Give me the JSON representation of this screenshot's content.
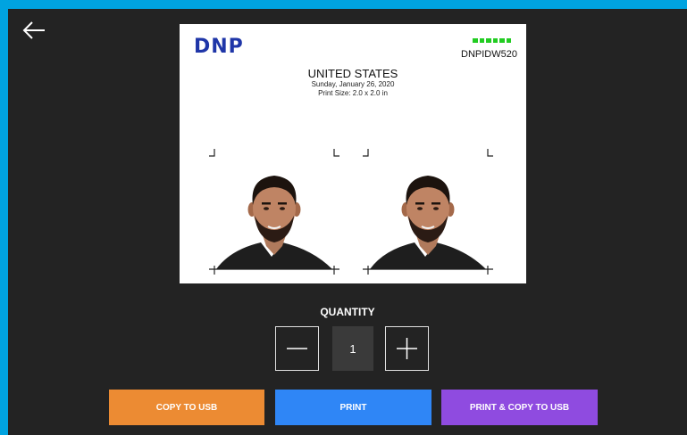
{
  "preview": {
    "brand": "DNP",
    "printer_model": "DNPIDW520",
    "country": "UNITED STATES",
    "date": "Sunday, January 26, 2020",
    "print_size": "Print Size: 2.0 x 2.0 in",
    "status_color": "#22cc22",
    "brand_color": "#1f36a8"
  },
  "quantity": {
    "label": "QUANTITY",
    "value": "1"
  },
  "actions": {
    "copy_usb": "COPY TO USB",
    "print": "PRINT",
    "print_copy_usb": "PRINT & COPY TO USB"
  },
  "colors": {
    "frame": "#00a3e0",
    "background": "#232323",
    "copy_usb_button": "#ec8b33",
    "print_button": "#2f86f6",
    "print_copy_usb_button": "#8f4be0"
  },
  "icons": {
    "back": "arrow-left-icon",
    "decrement": "minus-icon",
    "increment": "plus-icon"
  }
}
